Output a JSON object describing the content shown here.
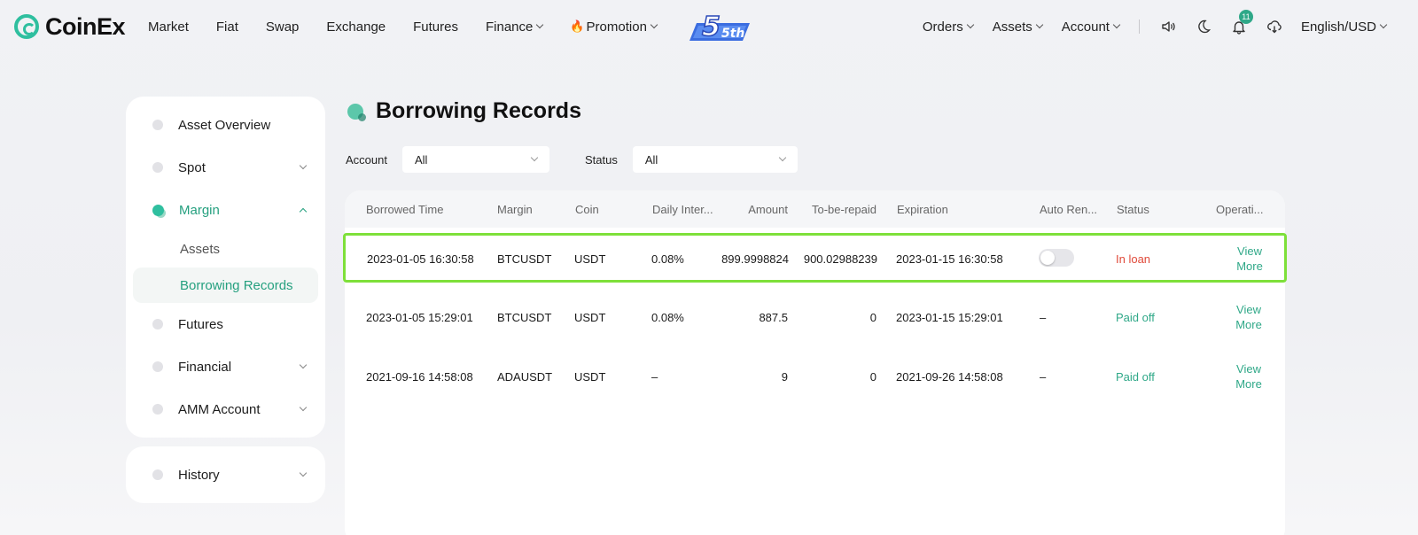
{
  "header": {
    "brand": "CoinEx",
    "nav": [
      "Market",
      "Fiat",
      "Swap",
      "Exchange",
      "Futures",
      "Finance",
      "Promotion"
    ],
    "anniversary": "5th",
    "right": [
      "Orders",
      "Assets",
      "Account"
    ],
    "notification_count": "11",
    "language": "English/USD"
  },
  "sidebar": {
    "items": [
      {
        "label": "Asset Overview"
      },
      {
        "label": "Spot"
      },
      {
        "label": "Margin"
      },
      {
        "label": "Futures"
      },
      {
        "label": "Financial"
      },
      {
        "label": "AMM Account"
      }
    ],
    "margin_sub": [
      "Assets",
      "Borrowing Records"
    ],
    "history": "History"
  },
  "main": {
    "title": "Borrowing Records",
    "filters": {
      "account_label": "Account",
      "account_value": "All",
      "status_label": "Status",
      "status_value": "All"
    },
    "columns": [
      "Borrowed Time",
      "Margin",
      "Coin",
      "Daily Inter...",
      "Amount",
      "To-be-repaid",
      "Expiration",
      "Auto Ren...",
      "Status",
      "Operati..."
    ],
    "rows": [
      {
        "time": "2023-01-05 16:30:58",
        "margin": "BTCUSDT",
        "coin": "USDT",
        "rate": "0.08%",
        "amount": "899.9998824",
        "repaid": "900.02988239",
        "expiration": "2023-01-15 16:30:58",
        "auto": "",
        "status": "In loan",
        "op1": "View",
        "op2": "More"
      },
      {
        "time": "2023-01-05 15:29:01",
        "margin": "BTCUSDT",
        "coin": "USDT",
        "rate": "0.08%",
        "amount": "887.5",
        "repaid": "0",
        "expiration": "2023-01-15 15:29:01",
        "auto": "–",
        "status": "Paid off",
        "op1": "View",
        "op2": "More"
      },
      {
        "time": "2021-09-16 14:58:08",
        "margin": "ADAUSDT",
        "coin": "USDT",
        "rate": "–",
        "amount": "9",
        "repaid": "0",
        "expiration": "2021-09-26 14:58:08",
        "auto": "–",
        "status": "Paid off",
        "op1": "View",
        "op2": "More"
      }
    ]
  },
  "colors": {
    "accent": "#2fa888",
    "loan": "#e04a3a",
    "highlight": "#7ee03a"
  }
}
